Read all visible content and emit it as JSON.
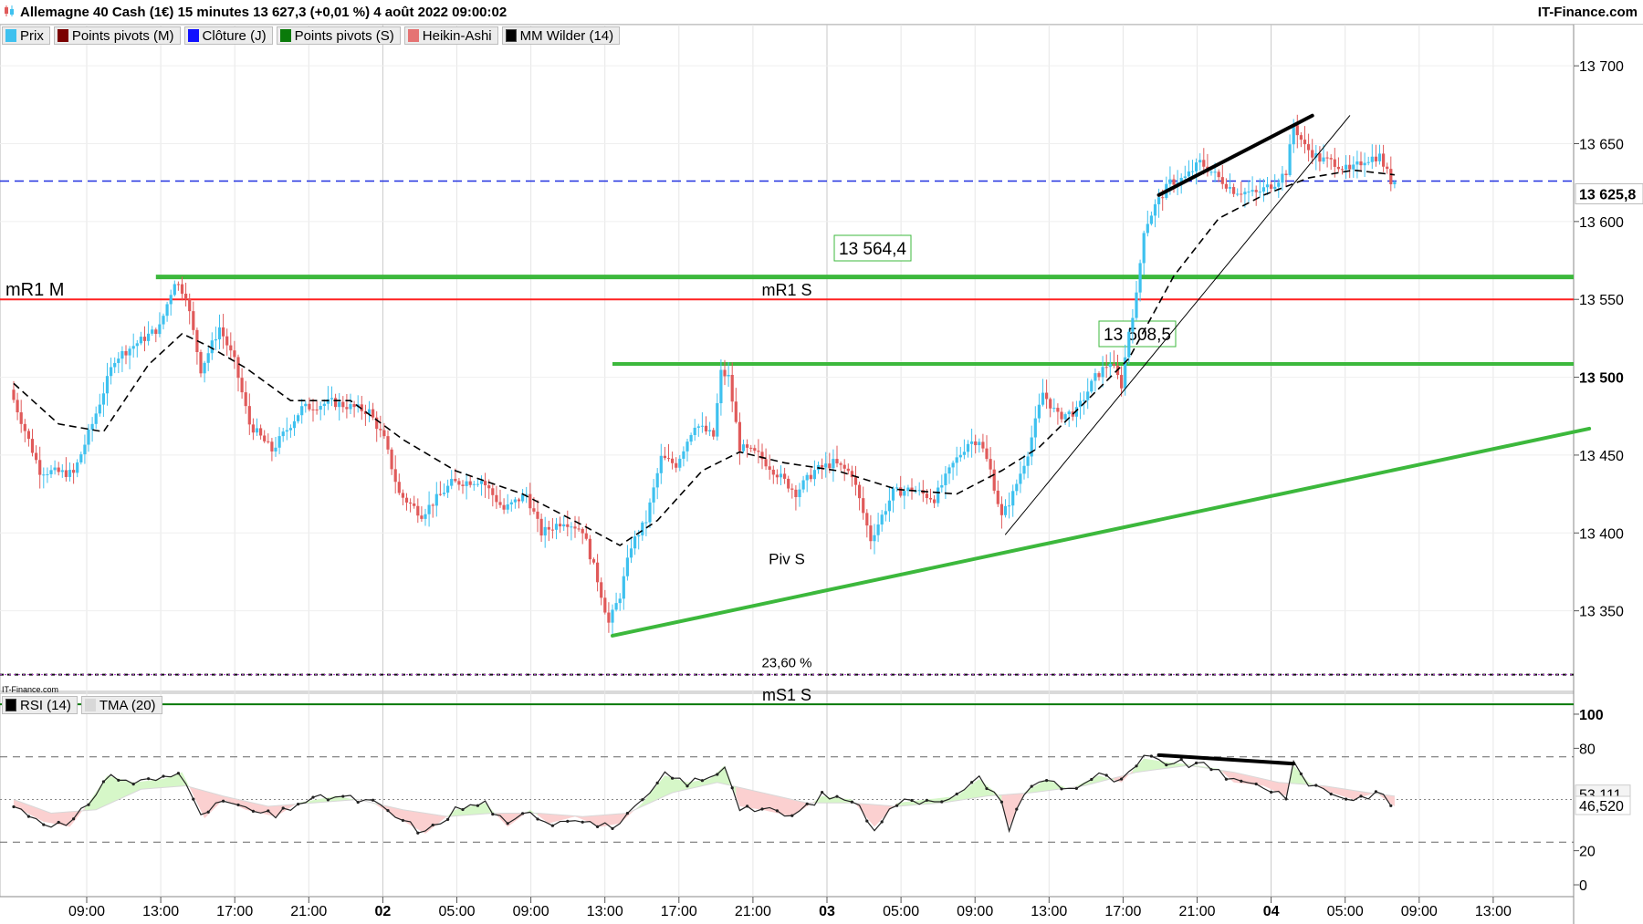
{
  "window": {
    "title": "Allemagne 40 Cash (1€) 15 minutes 13 627,3 (+0,01 %) 4 août 2022 09:00:02",
    "brand": "IT-Finance.com",
    "watermark": "IT-Finance.com"
  },
  "price_legend": [
    {
      "label": "Prix",
      "color": "#3ec1ef",
      "icon": "price-swatch-icon"
    },
    {
      "label": "Points pivots (M)",
      "color": "#7a0000",
      "icon": "pivot-monthly-swatch-icon"
    },
    {
      "label": "Clôture (J)",
      "color": "#1010ff",
      "icon": "close-daily-swatch-icon"
    },
    {
      "label": "Points pivots (S)",
      "color": "#0a7a0a",
      "icon": "pivot-weekly-swatch-icon"
    },
    {
      "label": "Heikin-Ashi",
      "color": "#e57373",
      "icon": "heikin-ashi-swatch-icon"
    },
    {
      "label": "MM Wilder (14)",
      "color": "#000000",
      "icon": "wilder-ma-swatch-icon"
    }
  ],
  "rsi_legend": [
    {
      "label": "RSI (14)",
      "color": "#000000",
      "icon": "rsi-swatch-icon"
    },
    {
      "label": "TMA (20)",
      "color": "#d8d8d8",
      "icon": "tma-swatch-icon"
    }
  ],
  "colors": {
    "bull": "#3ec1ef",
    "bear": "#e05a5a",
    "pivot_resistance": "#ff2020",
    "support_green": "#3cb83c",
    "close_line": "#2030e0",
    "fib": "#b040d0",
    "rsi_up_fill": "#d6f7c8",
    "rsi_down_fill": "#fbd0d0"
  },
  "chart_data": [
    {
      "type": "candlestick",
      "name": "Allemagne 40 Cash (1€) 15 minutes",
      "x_axis": {
        "tick_labels": [
          "09:00",
          "13:00",
          "17:00",
          "21:00",
          "02",
          "05:00",
          "09:00",
          "13:00",
          "17:00",
          "21:00",
          "03",
          "05:00",
          "09:00",
          "13:00",
          "17:00",
          "21:00",
          "04",
          "05:00",
          "09:00",
          "13:00"
        ],
        "bold_ticks": [
          "02",
          "03",
          "04"
        ]
      },
      "y_axis": {
        "ticks": [
          13350,
          13400,
          13450,
          13500,
          13550,
          13600,
          13650,
          13700
        ],
        "tick_labels": [
          "13 350",
          "13 400",
          "13 450",
          "13 500",
          "13 550",
          "13 600",
          "13 650",
          "13 700"
        ],
        "bold_tick": "13 500",
        "range": [
          13300,
          13720
        ],
        "last_value_label": "13 625,8"
      },
      "price_path": [
        {
          "t": 0,
          "p": 13492
        },
        {
          "t": 8,
          "p": 13440
        },
        {
          "t": 17,
          "p": 13438
        },
        {
          "t": 22,
          "p": 13470
        },
        {
          "t": 28,
          "p": 13512
        },
        {
          "t": 34,
          "p": 13522
        },
        {
          "t": 40,
          "p": 13532
        },
        {
          "t": 44,
          "p": 13562
        },
        {
          "t": 47,
          "p": 13553
        },
        {
          "t": 51,
          "p": 13505
        },
        {
          "t": 56,
          "p": 13532
        },
        {
          "t": 60,
          "p": 13510
        },
        {
          "t": 64,
          "p": 13470
        },
        {
          "t": 70,
          "p": 13453
        },
        {
          "t": 78,
          "p": 13480
        },
        {
          "t": 86,
          "p": 13484
        },
        {
          "t": 96,
          "p": 13478
        },
        {
          "t": 100,
          "p": 13460
        },
        {
          "t": 104,
          "p": 13425
        },
        {
          "t": 110,
          "p": 13412
        },
        {
          "t": 118,
          "p": 13432
        },
        {
          "t": 126,
          "p": 13434
        },
        {
          "t": 132,
          "p": 13415
        },
        {
          "t": 138,
          "p": 13425
        },
        {
          "t": 142,
          "p": 13400
        },
        {
          "t": 148,
          "p": 13408
        },
        {
          "t": 153,
          "p": 13402
        },
        {
          "t": 157,
          "p": 13370
        },
        {
          "t": 160,
          "p": 13342
        },
        {
          "t": 163,
          "p": 13360
        },
        {
          "t": 166,
          "p": 13392
        },
        {
          "t": 170,
          "p": 13408
        },
        {
          "t": 174,
          "p": 13448
        },
        {
          "t": 178,
          "p": 13444
        },
        {
          "t": 183,
          "p": 13470
        },
        {
          "t": 188,
          "p": 13462
        },
        {
          "t": 190,
          "p": 13503
        },
        {
          "t": 192,
          "p": 13500
        },
        {
          "t": 195,
          "p": 13455
        },
        {
          "t": 200,
          "p": 13450
        },
        {
          "t": 205,
          "p": 13438
        },
        {
          "t": 210,
          "p": 13426
        },
        {
          "t": 215,
          "p": 13440
        },
        {
          "t": 220,
          "p": 13445
        },
        {
          "t": 225,
          "p": 13438
        },
        {
          "t": 230,
          "p": 13396
        },
        {
          "t": 236,
          "p": 13426
        },
        {
          "t": 241,
          "p": 13428
        },
        {
          "t": 247,
          "p": 13422
        },
        {
          "t": 252,
          "p": 13444
        },
        {
          "t": 256,
          "p": 13458
        },
        {
          "t": 259,
          "p": 13460
        },
        {
          "t": 262,
          "p": 13440
        },
        {
          "t": 265,
          "p": 13410
        },
        {
          "t": 268,
          "p": 13425
        },
        {
          "t": 272,
          "p": 13452
        },
        {
          "t": 276,
          "p": 13490
        },
        {
          "t": 280,
          "p": 13475
        },
        {
          "t": 285,
          "p": 13478
        },
        {
          "t": 290,
          "p": 13500
        },
        {
          "t": 294,
          "p": 13510
        },
        {
          "t": 297,
          "p": 13495
        },
        {
          "t": 299,
          "p": 13530
        },
        {
          "t": 301,
          "p": 13552
        },
        {
          "t": 303,
          "p": 13595
        },
        {
          "t": 306,
          "p": 13610
        },
        {
          "t": 310,
          "p": 13625
        },
        {
          "t": 314,
          "p": 13628
        },
        {
          "t": 318,
          "p": 13638
        },
        {
          "t": 322,
          "p": 13630
        },
        {
          "t": 327,
          "p": 13620
        },
        {
          "t": 333,
          "p": 13618
        },
        {
          "t": 338,
          "p": 13625
        },
        {
          "t": 341,
          "p": 13632
        },
        {
          "t": 343,
          "p": 13662
        },
        {
          "t": 346,
          "p": 13648
        },
        {
          "t": 350,
          "p": 13640
        },
        {
          "t": 354,
          "p": 13638
        },
        {
          "t": 358,
          "p": 13632
        },
        {
          "t": 362,
          "p": 13640
        },
        {
          "t": 366,
          "p": 13642
        },
        {
          "t": 369,
          "p": 13626
        }
      ],
      "wilder_ma_path": [
        {
          "t": 0,
          "p": 13496
        },
        {
          "t": 12,
          "p": 13470
        },
        {
          "t": 24,
          "p": 13465
        },
        {
          "t": 36,
          "p": 13508
        },
        {
          "t": 45,
          "p": 13528
        },
        {
          "t": 52,
          "p": 13520
        },
        {
          "t": 62,
          "p": 13506
        },
        {
          "t": 74,
          "p": 13485
        },
        {
          "t": 90,
          "p": 13485
        },
        {
          "t": 104,
          "p": 13460
        },
        {
          "t": 118,
          "p": 13440
        },
        {
          "t": 136,
          "p": 13425
        },
        {
          "t": 152,
          "p": 13405
        },
        {
          "t": 162,
          "p": 13392
        },
        {
          "t": 172,
          "p": 13408
        },
        {
          "t": 184,
          "p": 13440
        },
        {
          "t": 194,
          "p": 13452
        },
        {
          "t": 206,
          "p": 13445
        },
        {
          "t": 220,
          "p": 13440
        },
        {
          "t": 236,
          "p": 13428
        },
        {
          "t": 252,
          "p": 13425
        },
        {
          "t": 264,
          "p": 13440
        },
        {
          "t": 274,
          "p": 13455
        },
        {
          "t": 288,
          "p": 13488
        },
        {
          "t": 298,
          "p": 13512
        },
        {
          "t": 310,
          "p": 13565
        },
        {
          "t": 322,
          "p": 13602
        },
        {
          "t": 334,
          "p": 13617
        },
        {
          "t": 346,
          "p": 13628
        },
        {
          "t": 358,
          "p": 13633
        },
        {
          "t": 369,
          "p": 13630
        }
      ],
      "horizontal_lines": [
        {
          "name": "mR1 M",
          "value": 13550,
          "color": "#ff2020",
          "style": "solid"
        },
        {
          "name": "mR1 S",
          "value": 13550,
          "color": "#ff2020",
          "style": "solid"
        },
        {
          "name": "13 564,4",
          "value": 13564.4,
          "color": "#3cb83c",
          "style": "thick"
        },
        {
          "name": "13 508,5",
          "value": 13508.5,
          "color": "#3cb83c",
          "style": "thick"
        },
        {
          "name": "Clôture (J)",
          "value": 13626,
          "color": "#2030e0",
          "style": "dashed"
        },
        {
          "name": "Piv S",
          "value": 13377,
          "color": "#000000",
          "style": "dotted"
        },
        {
          "name": "23,60 %",
          "value": 13309,
          "color": "#b040d0",
          "style": "dotted"
        },
        {
          "name": "mS1 S",
          "value": 13290,
          "color": "#0a7a0a",
          "style": "solid"
        }
      ],
      "labels": {
        "mr1_m": "mR1 M",
        "mr1_s": "mR1 S",
        "res_box": "13 564,4",
        "sup_box": "13 508,5",
        "piv_s": "Piv S",
        "fib": "23,60 %",
        "ms1_s": "mS1 S"
      },
      "trendlines": [
        {
          "name": "support-trendline",
          "from": {
            "t": 160,
            "p": 13334
          },
          "to": {
            "t": 421,
            "p": 13467
          },
          "color": "#3cb83c",
          "width": 4
        },
        {
          "name": "steep-uptrend",
          "from": {
            "t": 265,
            "p": 13399
          },
          "to": {
            "t": 357,
            "p": 13668
          },
          "color": "#000000",
          "width": 1
        },
        {
          "name": "price-divergence-line",
          "from": {
            "t": 306,
            "p": 13617
          },
          "to": {
            "t": 347,
            "p": 13668
          },
          "color": "#000000",
          "width": 4
        }
      ]
    },
    {
      "type": "line",
      "name": "RSI (14)",
      "y_axis": {
        "ticks": [
          0,
          20,
          80,
          100
        ],
        "tick_labels": [
          "0",
          "20",
          "80",
          "100"
        ],
        "range": [
          -8,
          108
        ],
        "last_values": [
          {
            "label": "53,111",
            "value": 53.111
          },
          {
            "label": "46,520",
            "value": 46.52
          }
        ]
      },
      "levels": [
        75,
        50,
        25
      ],
      "rsi_path": [
        {
          "t": 0,
          "p": 46
        },
        {
          "t": 8,
          "p": 37
        },
        {
          "t": 15,
          "p": 34
        },
        {
          "t": 20,
          "p": 48
        },
        {
          "t": 25,
          "p": 64
        },
        {
          "t": 32,
          "p": 60
        },
        {
          "t": 40,
          "p": 62
        },
        {
          "t": 45,
          "p": 66
        },
        {
          "t": 51,
          "p": 39
        },
        {
          "t": 56,
          "p": 50
        },
        {
          "t": 62,
          "p": 44
        },
        {
          "t": 70,
          "p": 40
        },
        {
          "t": 76,
          "p": 48
        },
        {
          "t": 86,
          "p": 52
        },
        {
          "t": 96,
          "p": 48
        },
        {
          "t": 102,
          "p": 40
        },
        {
          "t": 110,
          "p": 30
        },
        {
          "t": 118,
          "p": 44
        },
        {
          "t": 126,
          "p": 48
        },
        {
          "t": 132,
          "p": 34
        },
        {
          "t": 138,
          "p": 44
        },
        {
          "t": 143,
          "p": 36
        },
        {
          "t": 150,
          "p": 40
        },
        {
          "t": 157,
          "p": 34
        },
        {
          "t": 162,
          "p": 36
        },
        {
          "t": 168,
          "p": 48
        },
        {
          "t": 174,
          "p": 64
        },
        {
          "t": 180,
          "p": 60
        },
        {
          "t": 186,
          "p": 62
        },
        {
          "t": 190,
          "p": 70
        },
        {
          "t": 194,
          "p": 46
        },
        {
          "t": 200,
          "p": 44
        },
        {
          "t": 208,
          "p": 40
        },
        {
          "t": 216,
          "p": 52
        },
        {
          "t": 224,
          "p": 50
        },
        {
          "t": 230,
          "p": 34
        },
        {
          "t": 236,
          "p": 48
        },
        {
          "t": 244,
          "p": 50
        },
        {
          "t": 252,
          "p": 52
        },
        {
          "t": 258,
          "p": 62
        },
        {
          "t": 263,
          "p": 53
        },
        {
          "t": 266,
          "p": 34
        },
        {
          "t": 270,
          "p": 54
        },
        {
          "t": 276,
          "p": 62
        },
        {
          "t": 282,
          "p": 56
        },
        {
          "t": 290,
          "p": 64
        },
        {
          "t": 296,
          "p": 60
        },
        {
          "t": 302,
          "p": 74
        },
        {
          "t": 308,
          "p": 72
        },
        {
          "t": 316,
          "p": 70
        },
        {
          "t": 322,
          "p": 68
        },
        {
          "t": 326,
          "p": 60
        },
        {
          "t": 334,
          "p": 58
        },
        {
          "t": 340,
          "p": 52
        },
        {
          "t": 342,
          "p": 70
        },
        {
          "t": 346,
          "p": 60
        },
        {
          "t": 352,
          "p": 54
        },
        {
          "t": 358,
          "p": 50
        },
        {
          "t": 364,
          "p": 54
        },
        {
          "t": 369,
          "p": 46
        }
      ],
      "tma_path": [
        {
          "t": 0,
          "p": 50
        },
        {
          "t": 10,
          "p": 42
        },
        {
          "t": 22,
          "p": 44
        },
        {
          "t": 34,
          "p": 56
        },
        {
          "t": 46,
          "p": 58
        },
        {
          "t": 56,
          "p": 52
        },
        {
          "t": 68,
          "p": 46
        },
        {
          "t": 80,
          "p": 48
        },
        {
          "t": 92,
          "p": 50
        },
        {
          "t": 104,
          "p": 44
        },
        {
          "t": 116,
          "p": 40
        },
        {
          "t": 128,
          "p": 42
        },
        {
          "t": 140,
          "p": 42
        },
        {
          "t": 152,
          "p": 40
        },
        {
          "t": 164,
          "p": 42
        },
        {
          "t": 176,
          "p": 54
        },
        {
          "t": 188,
          "p": 60
        },
        {
          "t": 200,
          "p": 54
        },
        {
          "t": 212,
          "p": 48
        },
        {
          "t": 224,
          "p": 48
        },
        {
          "t": 236,
          "p": 46
        },
        {
          "t": 248,
          "p": 48
        },
        {
          "t": 260,
          "p": 52
        },
        {
          "t": 272,
          "p": 54
        },
        {
          "t": 286,
          "p": 58
        },
        {
          "t": 300,
          "p": 66
        },
        {
          "t": 314,
          "p": 70
        },
        {
          "t": 326,
          "p": 66
        },
        {
          "t": 338,
          "p": 60
        },
        {
          "t": 350,
          "p": 58
        },
        {
          "t": 362,
          "p": 54
        },
        {
          "t": 369,
          "p": 52
        }
      ],
      "trendlines": [
        {
          "name": "rsi-divergence-line",
          "from": {
            "t": 306,
            "p": 76
          },
          "to": {
            "t": 342,
            "p": 71
          },
          "color": "#000000",
          "width": 4
        }
      ]
    }
  ]
}
